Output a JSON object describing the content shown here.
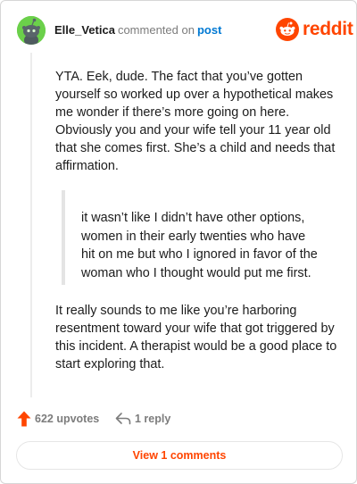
{
  "comment": {
    "username": "Elle_Vetica",
    "verb": "commented on",
    "post_link": "post",
    "paragraph_1": "YTA. Eek, dude. The fact that you’ve gotten yourself so worked up over a hypothetical makes me wonder if there’s more going on here. Obviously you and your wife tell your 11 year old that she comes first. She’s a child and needs that affirmation.",
    "quote_lines": [
      "it wasn’t like I didn’t have other options,",
      "women in their early twenties who have",
      "hit on me but who I ignored in favor of the",
      "woman who I thought would put me first."
    ],
    "paragraph_2": "It really sounds to me like you’re harboring resentment toward your wife that got triggered by this incident. A therapist would be a good place to start exploring that."
  },
  "brand": {
    "name": "reddit",
    "icon": "reddit-alien-icon",
    "color": "#ff4500"
  },
  "actions": {
    "upvotes_label": "622 upvotes",
    "upvote_icon": "upvote-arrow-icon",
    "reply_label": "1 reply",
    "reply_icon": "reply-arrow-icon"
  },
  "footer": {
    "view_button_label": "View 1 comments"
  },
  "colors": {
    "accent": "#ff4500",
    "link": "#0079d3",
    "avatar_bg": "#6bd04a",
    "muted_text": "#7c7c7c"
  }
}
